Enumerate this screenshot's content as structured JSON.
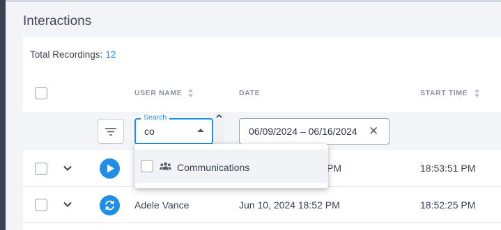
{
  "page": {
    "title": "Interactions"
  },
  "summary": {
    "label": "Total Recordings:",
    "count": "12"
  },
  "columns": {
    "user_name": "USER NAME",
    "date": "DATE",
    "start_time": "START TIME"
  },
  "filters": {
    "search_label": "Search",
    "search_value": "co",
    "date_range": "06/09/2024 – 06/16/2024"
  },
  "dropdown": {
    "options": [
      {
        "label": "Communications",
        "icon": "group-icon",
        "checked": false
      }
    ]
  },
  "rows": [
    {
      "user": "",
      "date": "PM",
      "start_time": "18:53:51 PM",
      "action_icon": "play-icon"
    },
    {
      "user": "Adele Vance",
      "date": "Jun 10, 2024 18:52 PM",
      "start_time": "18:52:25 PM",
      "action_icon": "sync-icon"
    }
  ],
  "colors": {
    "accent": "#1f8ee6",
    "rail": "#3c4154"
  }
}
